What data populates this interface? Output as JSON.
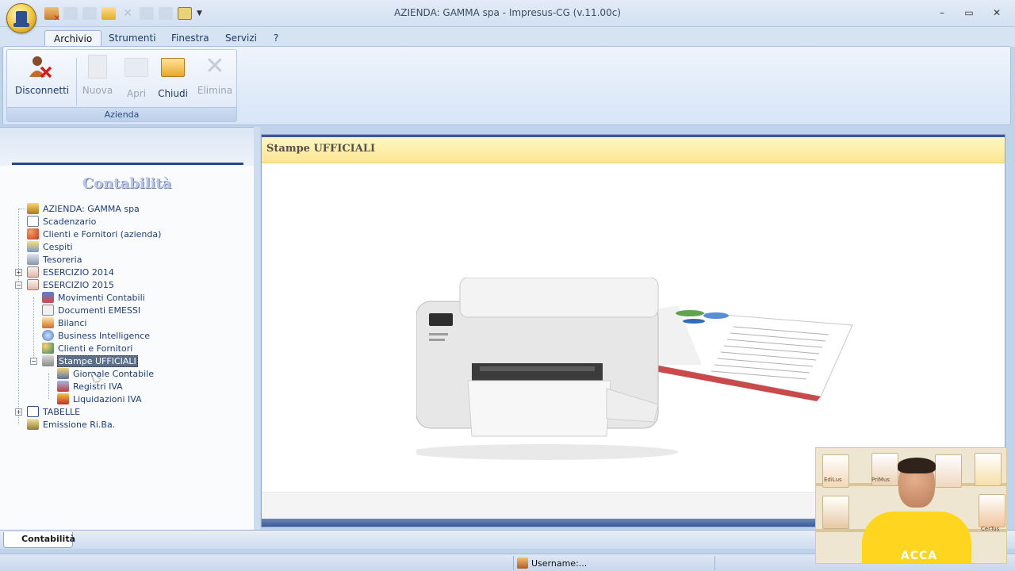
{
  "window": {
    "title": "AZIENDA: GAMMA spa - Impresus-CG (v.11.00c)"
  },
  "ribbon": {
    "tabs": [
      {
        "label": "Archivio"
      },
      {
        "label": "Strumenti"
      },
      {
        "label": "Finestra"
      },
      {
        "label": "Servizi"
      },
      {
        "label": "?"
      }
    ],
    "group_label": "Azienda",
    "buttons": [
      {
        "label": "Disconnetti",
        "icon": "disconnect-icon",
        "enabled": true
      },
      {
        "label": "Nuova",
        "icon": "new-document-icon",
        "enabled": false
      },
      {
        "label": "Apri",
        "icon": "open-folder-icon",
        "enabled": false
      },
      {
        "label": "Chiudi",
        "icon": "folder-icon",
        "enabled": true
      },
      {
        "label": "Elimina",
        "icon": "delete-icon",
        "enabled": false
      }
    ]
  },
  "sidebar": {
    "title": "Contabilità",
    "tree": [
      {
        "label": "AZIENDA:  GAMMA spa",
        "icon": "company-icon"
      },
      {
        "label": "Scadenzario",
        "icon": "calendar-icon"
      },
      {
        "label": "Clienti e Fornitori (azienda)",
        "icon": "people-icon"
      },
      {
        "label": "Cespiti",
        "icon": "assets-icon"
      },
      {
        "label": "Tesoreria",
        "icon": "bank-icon"
      },
      {
        "label": "ESERCIZIO 2014",
        "icon": "fiscal-year-icon"
      },
      {
        "label": "ESERCIZIO 2015",
        "icon": "fiscal-year-icon"
      },
      {
        "label": "Movimenti Contabili",
        "icon": "entries-icon"
      },
      {
        "label": "Documenti EMESSI",
        "icon": "documents-icon"
      },
      {
        "label": "Bilanci",
        "icon": "balance-icon"
      },
      {
        "label": "Business Intelligence",
        "icon": "bi-icon"
      },
      {
        "label": "Clienti e Fornitori",
        "icon": "people-icon"
      },
      {
        "label": "Stampe UFFICIALI",
        "icon": "printer-icon"
      },
      {
        "label": "Giornale Contabile",
        "icon": "journal-icon"
      },
      {
        "label": "Registri IVA",
        "icon": "vat-register-icon"
      },
      {
        "label": "Liquidazioni IVA",
        "icon": "vat-settlement-icon"
      },
      {
        "label": "TABELLE",
        "icon": "table-icon"
      },
      {
        "label": "Emissione Ri.Ba.",
        "icon": "riba-icon"
      }
    ]
  },
  "main": {
    "title": "Stampe UFFICIALI"
  },
  "bottom_tab": {
    "label": "Contabilità"
  },
  "status": {
    "username": "Username:..."
  },
  "webcam": {
    "shirt_text": "ACCA",
    "book_labels": [
      "EdiLus",
      "PriMus",
      "CerTus"
    ]
  }
}
